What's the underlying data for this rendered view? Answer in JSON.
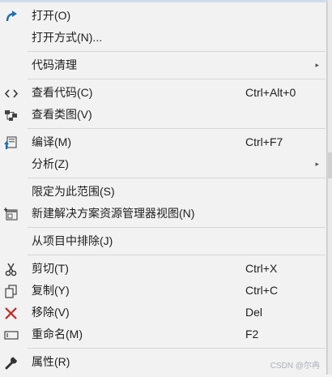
{
  "menu": {
    "items": [
      {
        "label": "打开(O)",
        "icon": "redo-arrow-icon"
      },
      {
        "label": "打开方式(N)..."
      },
      {
        "label": "代码清理",
        "submenu_arrow": "▸"
      },
      {
        "label": "查看代码(C)",
        "shortcut": "Ctrl+Alt+0",
        "icon": "code-brackets-icon"
      },
      {
        "label": "查看类图(V)",
        "icon": "class-diagram-icon"
      },
      {
        "label": "编译(M)",
        "shortcut": "Ctrl+F7",
        "icon": "compile-icon"
      },
      {
        "label": "分析(Z)",
        "submenu_arrow": "▸"
      },
      {
        "label": "限定为此范围(S)"
      },
      {
        "label": "新建解决方案资源管理器视图(N)",
        "icon": "new-explorer-view-icon"
      },
      {
        "label": "从项目中排除(J)"
      },
      {
        "label": "剪切(T)",
        "shortcut": "Ctrl+X",
        "icon": "scissors-icon"
      },
      {
        "label": "复制(Y)",
        "shortcut": "Ctrl+C",
        "icon": "copy-icon"
      },
      {
        "label": "移除(V)",
        "shortcut": "Del",
        "icon": "remove-x-icon"
      },
      {
        "label": "重命名(M)",
        "shortcut": "F2",
        "icon": "rename-icon"
      },
      {
        "label": "属性(R)",
        "icon": "wrench-icon"
      }
    ]
  },
  "watermark": "CSDN @尔冉",
  "colors": {
    "accent_blue": "#1f6fb2",
    "remove_red": "#c8261f"
  }
}
